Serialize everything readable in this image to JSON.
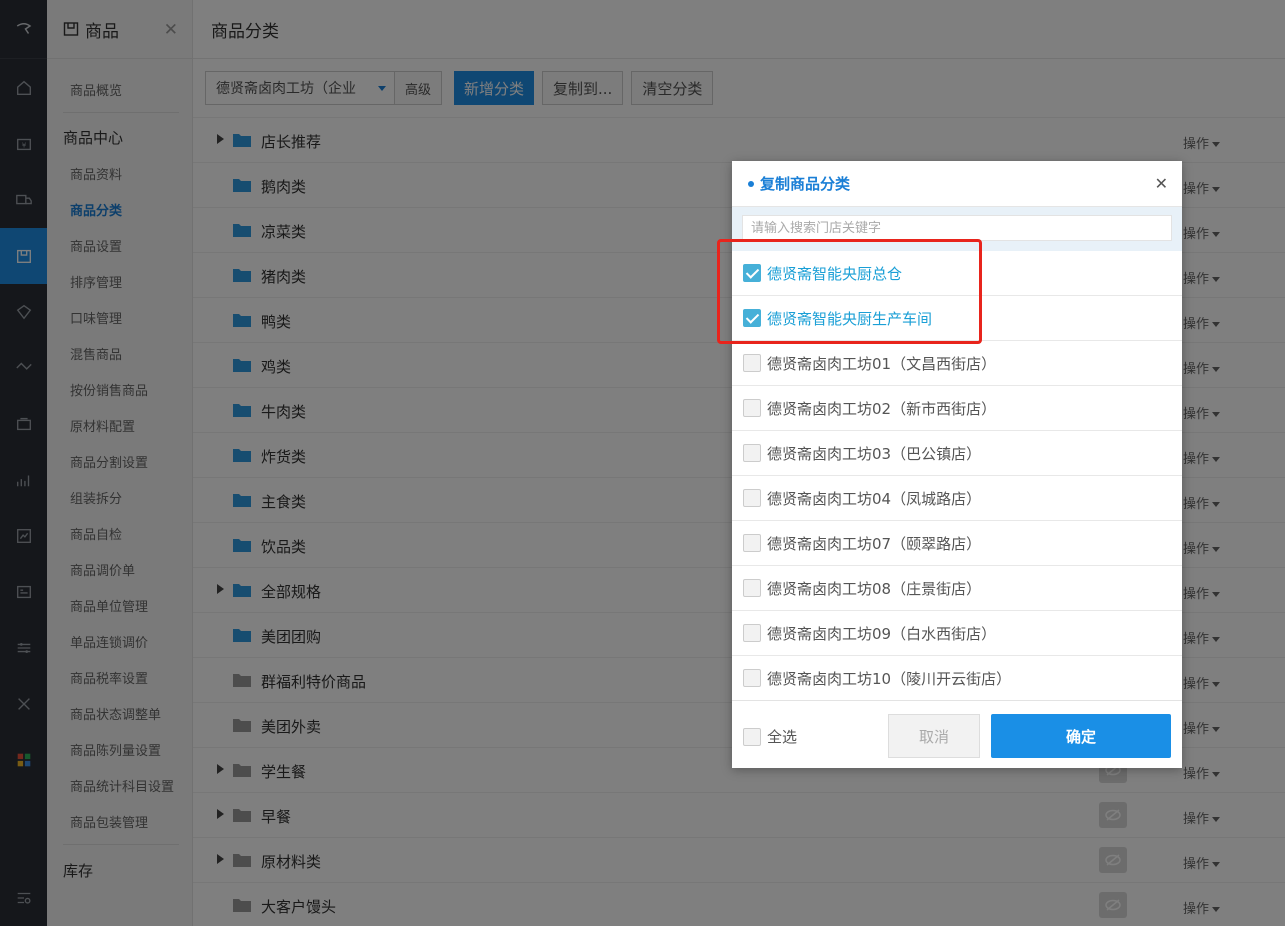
{
  "nav": {
    "title": "商品",
    "overview": "商品概览",
    "group_center": "商品中心",
    "items": [
      "商品资料",
      "商品分类",
      "商品设置",
      "排序管理",
      "口味管理",
      "混售商品",
      "按份销售商品",
      "原材料配置",
      "商品分割设置",
      "组装拆分",
      "商品自检",
      "商品调价单",
      "商品单位管理",
      "单品连锁调价",
      "商品税率设置",
      "商品状态调整单",
      "商品陈列量设置",
      "商品统计科目设置",
      "商品包装管理"
    ],
    "selected_index": 1,
    "group_stock": "库存"
  },
  "main": {
    "title": "商品分类",
    "store_select": "德贤斋卤肉工坊（企业",
    "advanced": "高级",
    "add_btn": "新增分类",
    "copy_btn": "复制到...",
    "clear_btn": "清空分类",
    "op_label": "操作",
    "rows": [
      {
        "name": "店长推荐",
        "expand": true
      },
      {
        "name": "鹅肉类",
        "expand": false
      },
      {
        "name": "凉菜类",
        "expand": false
      },
      {
        "name": "猪肉类",
        "expand": false
      },
      {
        "name": "鸭类",
        "expand": false
      },
      {
        "name": "鸡类",
        "expand": false
      },
      {
        "name": "牛肉类",
        "expand": false
      },
      {
        "name": "炸货类",
        "expand": false
      },
      {
        "name": "主食类",
        "expand": false
      },
      {
        "name": "饮品类",
        "expand": false
      },
      {
        "name": "全部规格",
        "expand": true
      },
      {
        "name": "美团团购",
        "expand": false
      },
      {
        "name": "群福利特价商品",
        "expand": false
      },
      {
        "name": "美团外卖",
        "expand": false
      },
      {
        "name": "学生餐",
        "expand": true
      },
      {
        "name": "早餐",
        "expand": true
      },
      {
        "name": "原材料类",
        "expand": true
      },
      {
        "name": "大客户馒头",
        "expand": false
      }
    ]
  },
  "modal": {
    "title": "复制商品分类",
    "search_placeholder": "请输入搜索门店关键字",
    "stores": [
      {
        "name": "德贤斋智能央厨总仓",
        "checked": true
      },
      {
        "name": "德贤斋智能央厨生产车间",
        "checked": true
      },
      {
        "name": "德贤斋卤肉工坊01（文昌西街店）",
        "checked": false
      },
      {
        "name": "德贤斋卤肉工坊02（新市西街店）",
        "checked": false
      },
      {
        "name": "德贤斋卤肉工坊03（巴公镇店）",
        "checked": false
      },
      {
        "name": "德贤斋卤肉工坊04（凤城路店）",
        "checked": false
      },
      {
        "name": "德贤斋卤肉工坊07（颐翠路店）",
        "checked": false
      },
      {
        "name": "德贤斋卤肉工坊08（庄景街店）",
        "checked": false
      },
      {
        "name": "德贤斋卤肉工坊09（白水西街店）",
        "checked": false
      },
      {
        "name": "德贤斋卤肉工坊10（陵川开云街店）",
        "checked": false
      }
    ],
    "select_all": "全选",
    "cancel": "取消",
    "confirm": "确定"
  },
  "colors": {
    "accent": "#1f8ee6",
    "rail": "#2b2f36",
    "highlight": "#e8241c"
  }
}
